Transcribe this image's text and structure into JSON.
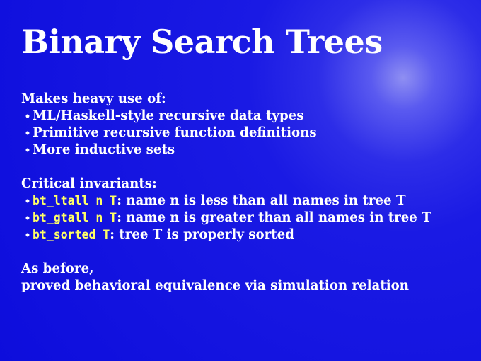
{
  "title": "Binary Search Trees",
  "section1": {
    "heading": "Makes heavy use of:",
    "bullets": [
      "ML/Haskell-style recursive data types",
      "Primitive recursive function definitions",
      "More inductive sets"
    ]
  },
  "section2": {
    "heading": "Critical invariants:",
    "bullets": [
      {
        "code": "bt_ltall n T",
        "text": ": name n is less than all names in tree T"
      },
      {
        "code": "bt_gtall n T",
        "text": ": name n is greater than all names in tree T"
      },
      {
        "code": "bt_sorted T",
        "text": ": tree T is properly sorted"
      }
    ]
  },
  "section3": {
    "lines": [
      "As before,",
      "proved behavioral equivalence via simulation relation"
    ]
  },
  "colors": {
    "background": "#1a1ae4",
    "text": "#ffffff",
    "code": "#ffff66"
  }
}
